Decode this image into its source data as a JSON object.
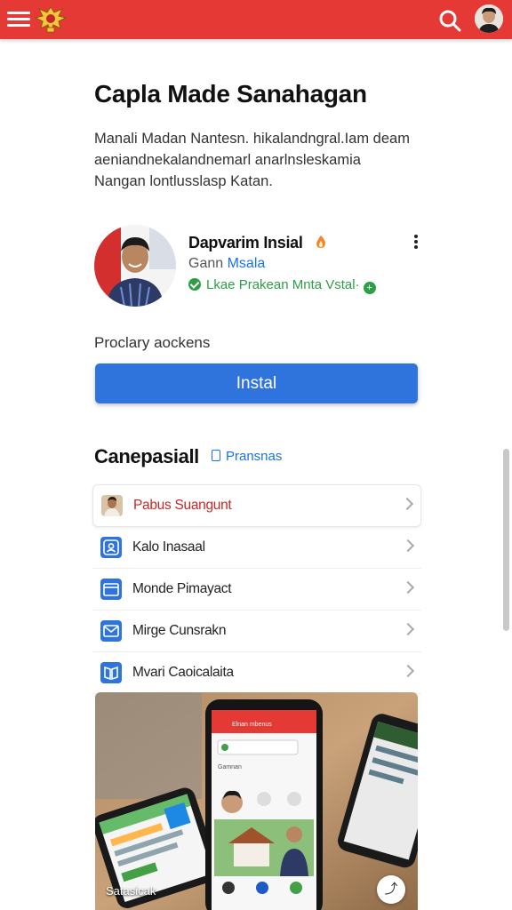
{
  "header": {
    "menu_icon": "hamburger-menu-icon",
    "logo_icon": "garuda-emblem-icon",
    "search_icon": "search-icon",
    "accent_color": "#e53935"
  },
  "article": {
    "title": "Capla Made Sanahagan",
    "description": "Manali Madan Nantesn. hikalandngral.Iam deam aeniandnekalandnemarl anarlnsleskamia Nangan lontlusslasp Katan."
  },
  "profile": {
    "name": "Dapvarim Insial",
    "subtitle_prefix": "Gann",
    "subtitle_link": "Msala",
    "status": "Lkae Prakean Mnta Vstal·",
    "status_color": "#2e9e45"
  },
  "install": {
    "label": "Proclary aockens",
    "button_label": "Instal",
    "button_color": "#2f74dc"
  },
  "section": {
    "title": "Canepasiall",
    "link_label": "Pransnas",
    "items": [
      {
        "label": "Pabus Suangunt",
        "icon": "thumbnail-photo"
      },
      {
        "label": "Kalo Inasaal",
        "icon": "person-icon"
      },
      {
        "label": "Monde Pimayact",
        "icon": "folder-icon"
      },
      {
        "label": "Mirge Cunsrakn",
        "icon": "mail-icon"
      },
      {
        "label": "Mvari Caoicalaita",
        "icon": "book-icon"
      }
    ]
  },
  "hero": {
    "caption": "Satasicak",
    "phone_header": "Elnan mbenus",
    "phone_field": "Gamnan"
  }
}
